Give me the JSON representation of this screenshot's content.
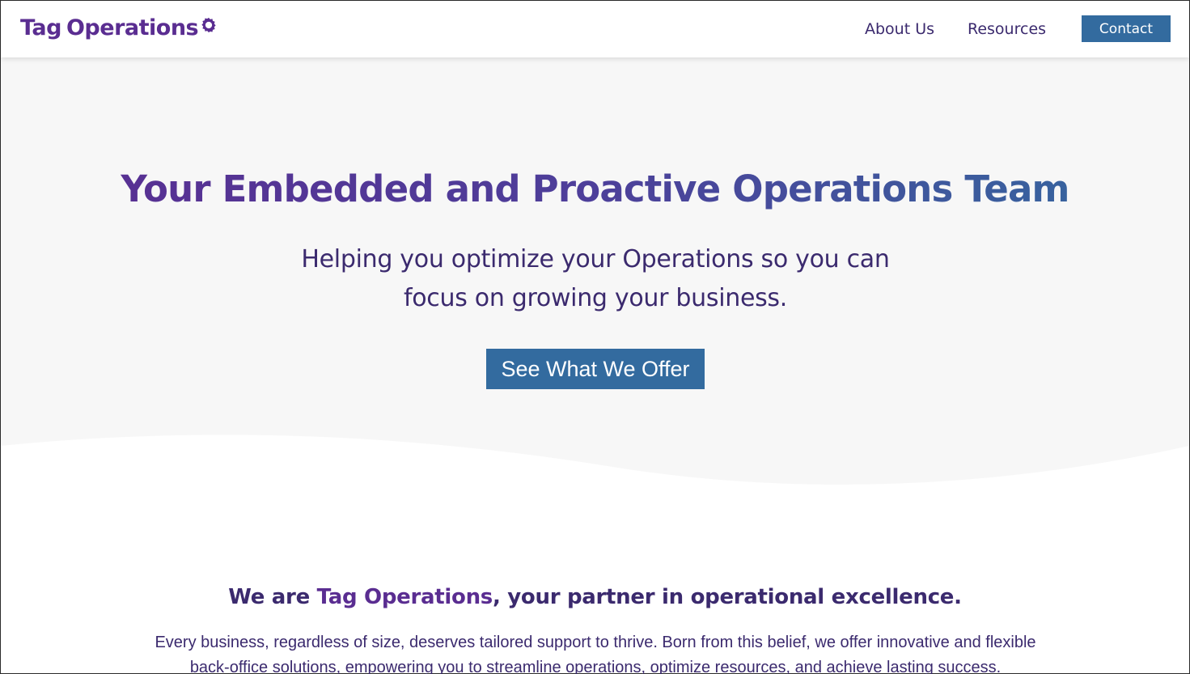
{
  "brand": {
    "name_part1": "Tag",
    "name_part2": "Operations",
    "primary_color": "#5a2d91",
    "accent_color": "#336b9f"
  },
  "nav": {
    "about_label": "About Us",
    "resources_label": "Resources",
    "contact_label": "Contact"
  },
  "hero": {
    "title": "Your Embedded and Proactive Operations Team",
    "subtitle": "Helping you optimize your Operations so you can focus on growing your business.",
    "cta_label": "See What We Offer"
  },
  "about": {
    "heading_prefix": "We are ",
    "heading_brand": "Tag Operations",
    "heading_suffix": ", your partner in operational excellence.",
    "body": "Every business, regardless of size, deserves tailored support to thrive. Born from this belief, we offer innovative and flexible back-office solutions, empowering you to streamline operations, optimize resources, and achieve lasting success."
  }
}
